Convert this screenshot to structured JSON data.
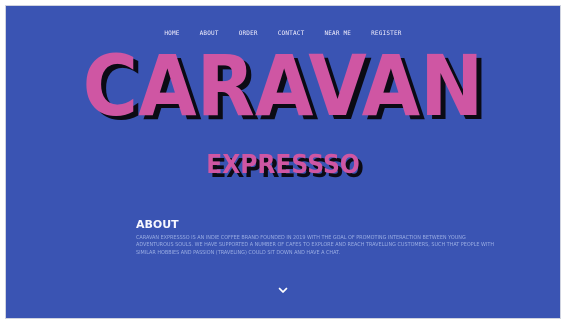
{
  "nav": {
    "items": [
      "HOME",
      "ABOUT",
      "ORDER",
      "CONTACT",
      "NEAR ME",
      "REGISTER"
    ]
  },
  "hero": {
    "title": "CARAVAN",
    "subtitle": "EXPRESSSO"
  },
  "about": {
    "heading": "ABOUT",
    "body": "Caravan Expressso is an indie coffee brand founded in 2019 with the goal of promoting interaction between young adventurous souls. We have supported a number of cafes to explore and reach travelling customers, such that people with similar hobbies and passion (traveling) could sit down and have a chat."
  },
  "icons": {
    "scroll": "chevron-down-icon"
  },
  "colors": {
    "background": "#3a54b3",
    "accent": "#cf56a3",
    "shadow": "#0b0b14",
    "text": "#f6f2ff",
    "body_text": "#9fb2e6"
  }
}
